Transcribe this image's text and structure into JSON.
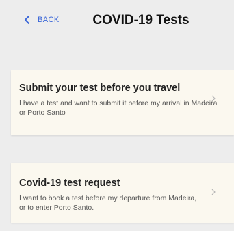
{
  "header": {
    "back_label": "BACK",
    "title": "COVID-19 Tests"
  },
  "cards": [
    {
      "title": "Submit your test before you travel",
      "description": "I have a test and want to submit it before my arrival in Madeira or Porto Santo"
    },
    {
      "title": "Covid-19 test request",
      "description": "I want to book a test before my departure from Madeira, or to enter Porto Santo."
    }
  ],
  "colors": {
    "background": "#ededed",
    "card": "#fbf8ef",
    "accent": "#3a66d8"
  },
  "icons": {
    "back": "chevron-left-icon",
    "card_arrow": "chevron-right-icon"
  }
}
